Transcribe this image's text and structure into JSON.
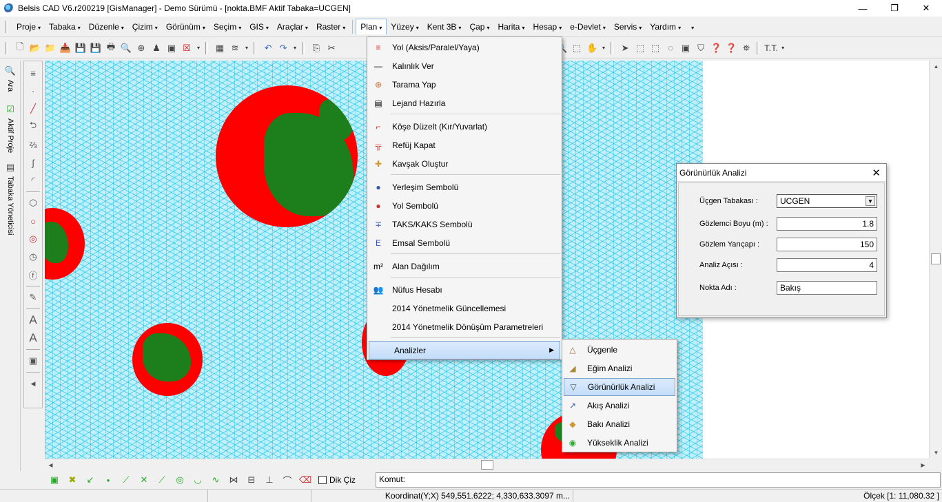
{
  "window": {
    "title": "Belsis CAD V6.r200219 [GisManager] - Demo Sürümü - [nokta.BMF  Aktif Tabaka=UCGEN]",
    "minimize": "—",
    "maximize": "❐",
    "close": "✕"
  },
  "menubar": {
    "items": [
      {
        "label": "Proje"
      },
      {
        "label": "Tabaka"
      },
      {
        "label": "Düzenle"
      },
      {
        "label": "Çizim"
      },
      {
        "label": "Görünüm"
      },
      {
        "label": "Seçim"
      },
      {
        "label": "GIS"
      },
      {
        "label": "Araçlar"
      },
      {
        "label": "Raster"
      },
      {
        "label": "Plan"
      },
      {
        "label": "Yüzey"
      },
      {
        "label": "Kent 3B"
      },
      {
        "label": "Çap"
      },
      {
        "label": "Harita"
      },
      {
        "label": "Hesap"
      },
      {
        "label": "e-Devlet"
      },
      {
        "label": "Servis"
      },
      {
        "label": "Yardım"
      }
    ],
    "caret": "▾"
  },
  "sidetabs": {
    "ara": "Ara",
    "aktif_proje": "Aktif Proje",
    "tabaka_yoneticisi": "Tabaka Yöneticisi"
  },
  "plan_menu": {
    "items": [
      {
        "label": "Yol (Aksis/Paralel/Yaya)",
        "icon": "≡"
      },
      {
        "label": "Kalınlık Ver",
        "icon": "—"
      },
      {
        "label": "Tarama Yap",
        "icon": "⊕"
      },
      {
        "label": "Lejand Hazırla",
        "icon": "▤"
      },
      {
        "label": "Köşe Düzelt (Kır/Yuvarlat)",
        "icon": "⌐"
      },
      {
        "label": "Refüj Kapat",
        "icon": "╦"
      },
      {
        "label": "Kavşak Oluştur",
        "icon": "✚"
      },
      {
        "label": "Yerleşim Sembolü",
        "icon": "●"
      },
      {
        "label": "Yol Sembolü",
        "icon": "●"
      },
      {
        "label": "TAKS/KAKS Sembolü",
        "icon": "∓"
      },
      {
        "label": "Emsal Sembolü",
        "icon": "E"
      },
      {
        "label": "Alan Dağılım",
        "icon": "m²"
      },
      {
        "label": "Nüfus Hesabı",
        "icon": "👥"
      },
      {
        "label": "2014 Yönetmelik Güncellemesi",
        "icon": ""
      },
      {
        "label": "2014 Yönetmelik Dönüşüm Parametreleri",
        "icon": ""
      },
      {
        "label": "Analizler",
        "icon": "",
        "submenu_arrow": "▶"
      }
    ]
  },
  "analiz_submenu": {
    "items": [
      {
        "label": "Üçgenle",
        "icon": "△"
      },
      {
        "label": "Eğim Analizi",
        "icon": "◢"
      },
      {
        "label": "Görünürlük Analizi",
        "icon": "▽"
      },
      {
        "label": "Akış Analizi",
        "icon": "↗"
      },
      {
        "label": "Bakı Analizi",
        "icon": "◆"
      },
      {
        "label": "Yükseklik Analizi",
        "icon": "◉"
      }
    ]
  },
  "dialog": {
    "title": "Görünürlük Analizi",
    "close": "✕",
    "fields": {
      "ucgen_tabakasi": {
        "label": "Üçgen Tabakası :",
        "value": "UCGEN"
      },
      "gozlemci_boyu": {
        "label": "Gözlemci Boyu (m) :",
        "value": "1.8"
      },
      "gozlem_yaricapi": {
        "label": "Gözlem Yarıçapı :",
        "value": "150"
      },
      "analiz_acisi": {
        "label": "Analiz Açısı :",
        "value": "4"
      },
      "nokta_adi": {
        "label": "Nokta Adı :",
        "value": "Bakış"
      }
    }
  },
  "bottombar": {
    "dik_ciz": "Dik Çiz",
    "komut_label": "Komut:"
  },
  "statusbar": {
    "koordinat": "Koordinat(Y;X)  549,551.6222; 4,330,633.3097 m...",
    "olcek": "Ölçek [1: 11,080.32 ]"
  },
  "colors": {
    "mesh": "#00b9e1",
    "analysis_red": "#ff0000",
    "analysis_green": "#1c7f1c",
    "menu_highlight": "#c4ddfa"
  }
}
